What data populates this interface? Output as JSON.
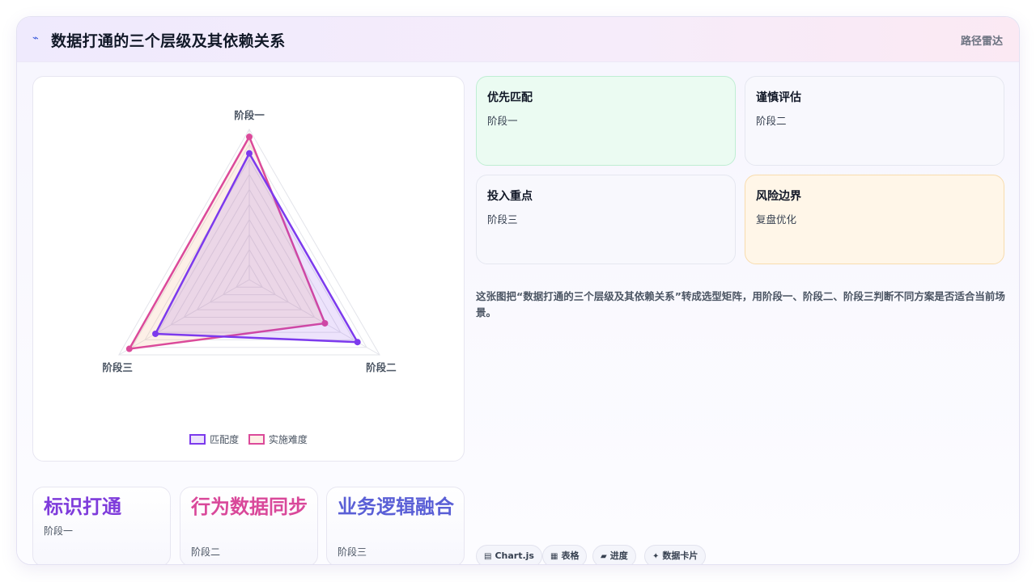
{
  "header": {
    "title": "数据打通的三个层级及其依赖关系",
    "tag": "路径雷达",
    "logo_icon": "sparkline-icon"
  },
  "chart_data": {
    "type": "radar",
    "axes": [
      "阶段一",
      "阶段二",
      "阶段三"
    ],
    "rmax": 100,
    "rings": 10,
    "series": [
      {
        "name": "匹配度",
        "values": [
          84,
          83,
          72
        ],
        "color": "#7c3aed",
        "fill": "rgba(124, 58, 237, 0.14)"
      },
      {
        "name": "实施难度",
        "values": [
          95,
          58,
          92
        ],
        "color": "#db4a9a",
        "fill": "rgba(245, 170, 120, 0.18)"
      }
    ],
    "legend": "bottom"
  },
  "stats": [
    {
      "title": "标识打通",
      "sub": "阶段一",
      "color": "#7e3bdb"
    },
    {
      "title": "行为数据同步",
      "sub": "阶段二",
      "color": "#d9489a"
    },
    {
      "title": "业务逻辑融合",
      "sub": "阶段三",
      "color": "#5a5fd6"
    }
  ],
  "cards": [
    {
      "title": "优先匹配",
      "sub": "阶段一",
      "tone": "green"
    },
    {
      "title": "谨慎评估",
      "sub": "阶段二",
      "tone": "neutral"
    },
    {
      "title": "投入重点",
      "sub": "阶段三",
      "tone": "neutral"
    },
    {
      "title": "风险边界",
      "sub": "复盘优化",
      "tone": "amber"
    }
  ],
  "description": "这张图把“数据打通的三个层级及其依赖关系”转成选型矩阵，用阶段一、阶段二、阶段三判断不同方案是否适合当前场景。",
  "chips": [
    {
      "icon": "chart-icon",
      "glyph": "▤",
      "label": "Chart.js"
    },
    {
      "icon": "table-icon",
      "glyph": "▦",
      "label": "表格"
    },
    {
      "icon": "progress-icon",
      "glyph": "▰",
      "label": "进度"
    },
    {
      "icon": "card-icon",
      "glyph": "✦",
      "label": "数据卡片"
    }
  ]
}
